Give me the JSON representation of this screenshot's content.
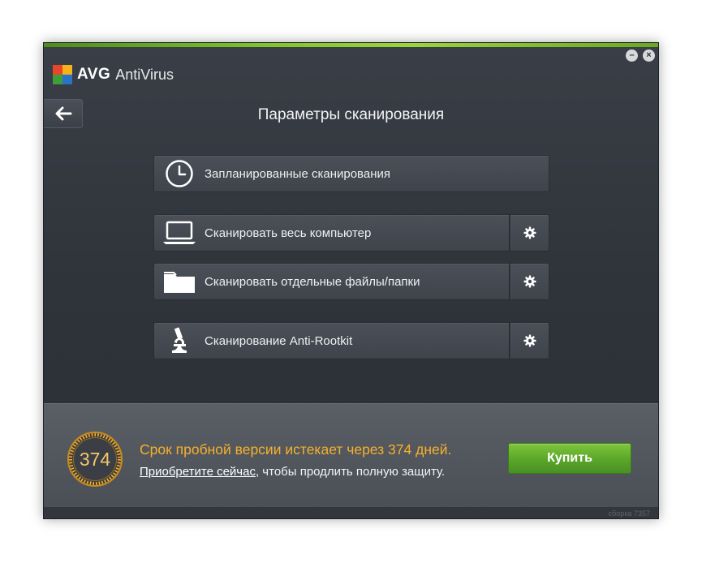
{
  "app": {
    "brand": "AVG",
    "product": "AntiVirus",
    "minimize_glyph": "–",
    "close_glyph": "×"
  },
  "page": {
    "title": "Параметры сканирования"
  },
  "scans": [
    {
      "label": "Запланированные сканирования",
      "icon": "clock-icon",
      "has_settings": false
    },
    {
      "label": "Сканировать весь компьютер",
      "icon": "laptop-icon",
      "has_settings": true
    },
    {
      "label": "Сканировать отдельные файлы/папки",
      "icon": "folder-icon",
      "has_settings": true
    },
    {
      "label": "Сканирование Anti-Rootkit",
      "icon": "microscope-icon",
      "has_settings": true
    }
  ],
  "trial": {
    "days": "374",
    "message": "Срок пробной версии истекает через 374 дней.",
    "link_text": "Приобретите сейчас",
    "suffix_text": ", чтобы продлить полную защиту.",
    "buy_label": "Купить"
  },
  "footer": {
    "build": "сборка 7357"
  },
  "colors": {
    "accent_green": "#7ec42a",
    "trial_orange": "#f7b02a",
    "buy_green": "#5aa52a"
  }
}
